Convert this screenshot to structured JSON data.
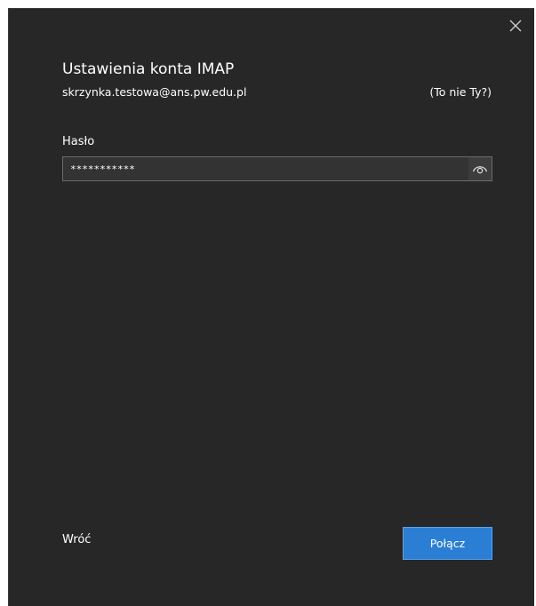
{
  "dialog": {
    "title": "Ustawienia konta IMAP",
    "email": "skrzynka.testowa@ans.pw.edu.pl",
    "not_you_link": "(To nie Ty?)",
    "close_icon": "close-icon"
  },
  "password": {
    "label": "Hasło",
    "value": "***********",
    "reveal_icon": "eye-icon"
  },
  "footer": {
    "back_label": "Wróć",
    "connect_label": "Połącz"
  },
  "colors": {
    "background": "#272727",
    "accent": "#2a7fd4",
    "field_background": "#333333",
    "field_border": "#6b6b6b"
  }
}
